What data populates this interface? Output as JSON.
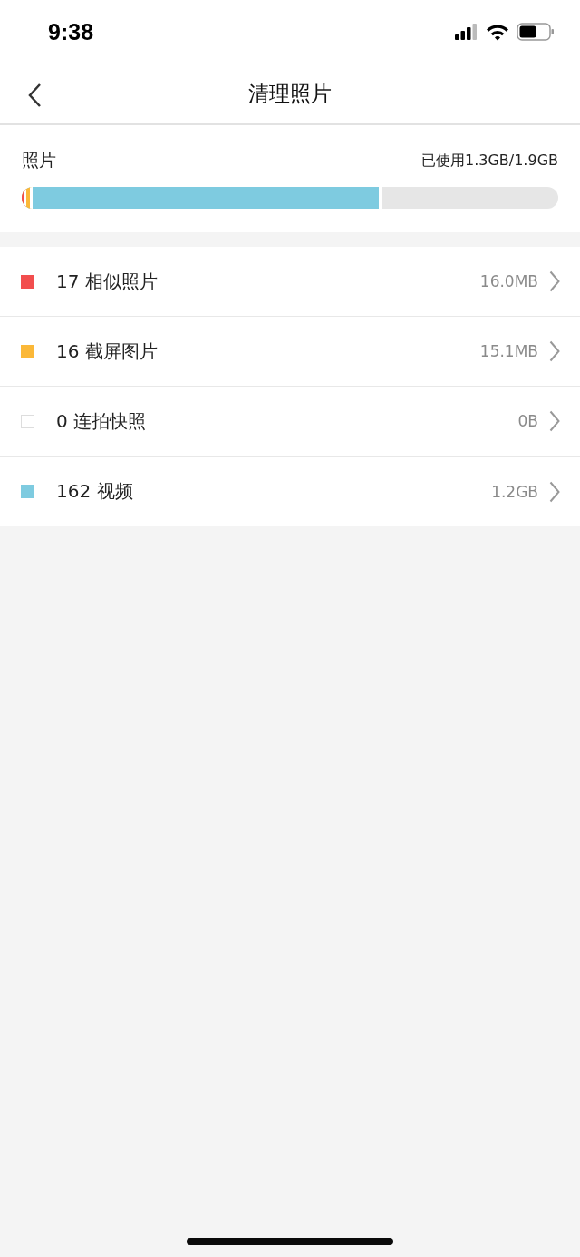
{
  "status_bar": {
    "time": "9:38"
  },
  "nav": {
    "title": "清理照片"
  },
  "storage": {
    "label": "照片",
    "usage": "已使用1.3GB/1.9GB",
    "segments": [
      {
        "color": "#f24e4e",
        "level": 0.008
      },
      {
        "color": "#fbb838",
        "level": 0.02
      },
      {
        "color": "#7ecbe0",
        "level": 0.67
      }
    ]
  },
  "categories": [
    {
      "color": "#f24e4e",
      "label": "17 相似照片",
      "size": "16.0MB"
    },
    {
      "color": "#fbb838",
      "label": "16 截屏图片",
      "size": "15.1MB"
    },
    {
      "color": "#ffffff",
      "label": "0 连拍快照",
      "size": "0B"
    },
    {
      "color": "#7ecbe0",
      "label": "162 视频",
      "size": "1.2GB"
    }
  ]
}
